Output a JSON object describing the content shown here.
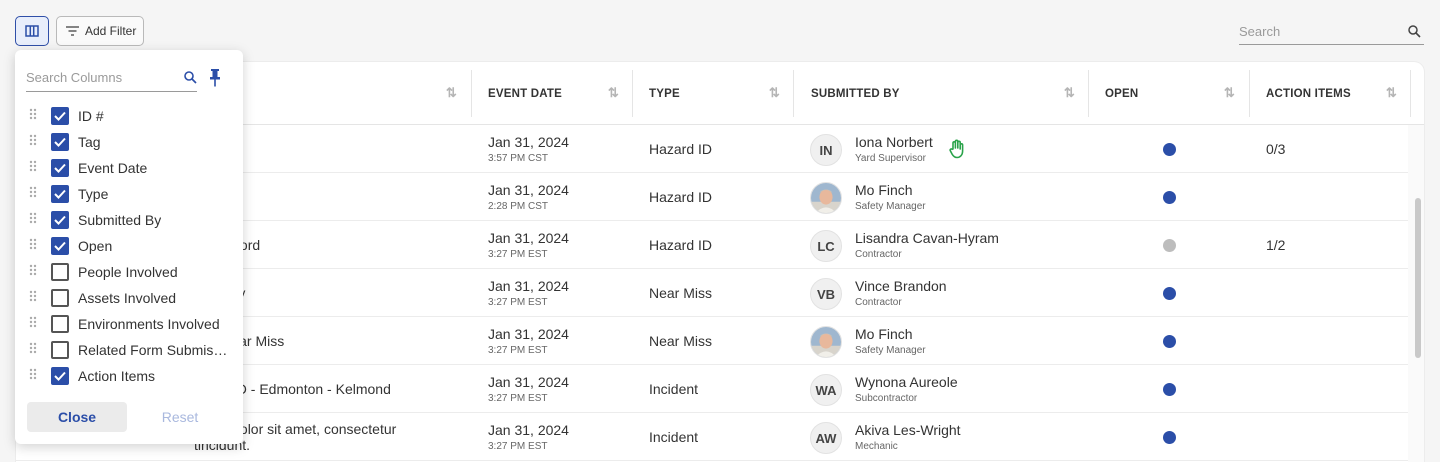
{
  "toolbar": {
    "add_filter_label": "Add Filter",
    "search_placeholder": "Search"
  },
  "columns_panel": {
    "search_placeholder": "Search Columns",
    "items": [
      {
        "label": "ID #",
        "checked": true
      },
      {
        "label": "Tag",
        "checked": true
      },
      {
        "label": "Event Date",
        "checked": true
      },
      {
        "label": "Type",
        "checked": true
      },
      {
        "label": "Submitted By",
        "checked": true
      },
      {
        "label": "Open",
        "checked": true
      },
      {
        "label": "People Involved",
        "checked": false
      },
      {
        "label": "Assets Involved",
        "checked": false
      },
      {
        "label": "Environments Involved",
        "checked": false
      },
      {
        "label": "Related Form Submissions",
        "checked": false
      },
      {
        "label": "Action Items",
        "checked": true
      }
    ],
    "close_label": "Close",
    "reset_label": "Reset"
  },
  "table": {
    "headers": {
      "event_date": "EVENT DATE",
      "type": "TYPE",
      "submitted_by": "SUBMITTED BY",
      "open": "OPEN",
      "action_items": "ACTION ITEMS"
    },
    "rows": [
      {
        "tag_line1": "",
        "tag_line2": "",
        "date": "Jan 31, 2024",
        "time": "3:57 PM CST",
        "type": "Hazard ID",
        "initials": "IN",
        "photo": false,
        "name": "Iona Norbert",
        "role": "Yard Supervisor",
        "open_color": "#2b4ea8",
        "action_items": "0/3",
        "hand_icon": true
      },
      {
        "tag_line1": "",
        "tag_line2": "",
        "date": "Jan 31, 2024",
        "time": "2:28 PM CST",
        "type": "Hazard ID",
        "initials": "",
        "photo": true,
        "name": "Mo Finch",
        "role": "Safety Manager",
        "open_color": "#2b4ea8",
        "action_items": "",
        "hand_icon": false
      },
      {
        "tag_line1": "- Brantford",
        "tag_line2": "",
        "date": "Jan 31, 2024",
        "time": "3:27 PM EST",
        "type": "Hazard ID",
        "initials": "LC",
        "photo": false,
        "name": "Lisandra Cavan-Hyram",
        "role": "Contractor",
        "open_color": "#bdbdbd",
        "action_items": "1/2",
        "hand_icon": false
      },
      {
        "tag_line1": "capacity",
        "tag_line2": "",
        "date": "Jan 31, 2024",
        "time": "3:27 PM EST",
        "type": "Near Miss",
        "initials": "VB",
        "photo": false,
        "name": "Vince Brandon",
        "role": "Contractor",
        "open_color": "#2b4ea8",
        "action_items": "",
        "hand_icon": false
      },
      {
        "tag_line1": "ps - Near Miss",
        "tag_line2": "",
        "date": "Jan 31, 2024",
        "time": "3:27 PM EST",
        "type": "Near Miss",
        "initials": "",
        "photo": true,
        "name": "Mo Finch",
        "role": "Safety Manager",
        "open_color": "#2b4ea8",
        "action_items": "",
        "hand_icon": false
      },
      {
        "tag_line1": "ble - MD - Edmonton - Kelmond",
        "tag_line2": "",
        "date": "Jan 31, 2024",
        "time": "3:27 PM EST",
        "type": "Incident",
        "initials": "WA",
        "photo": false,
        "name": "Wynona Aureole",
        "role": "Subcontractor",
        "open_color": "#2b4ea8",
        "action_items": "",
        "hand_icon": false
      },
      {
        "tag_line1": "psum dolor sit amet, consectetur",
        "tag_line2": "tincidunt.",
        "date": "Jan 31, 2024",
        "time": "3:27 PM EST",
        "type": "Incident",
        "initials": "AW",
        "photo": false,
        "name": "Akiva Les-Wright",
        "role": "Mechanic",
        "open_color": "#2b4ea8",
        "action_items": "",
        "hand_icon": false
      }
    ]
  },
  "colors": {
    "accent": "#2b4ea8",
    "hand_icon": "#2aa34a"
  }
}
